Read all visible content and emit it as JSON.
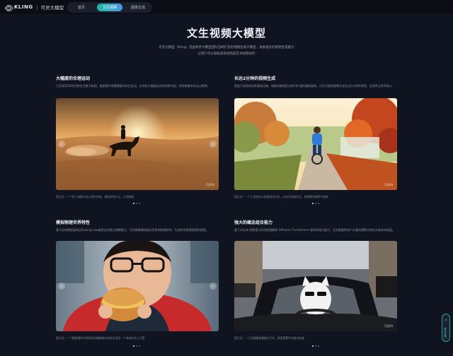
{
  "app": {
    "logo_text": "KLING",
    "logo_sub": "可灵大模型"
  },
  "nav": {
    "tabs": [
      {
        "label": "首页"
      },
      {
        "label": "文生视频"
      },
      {
        "label": "图像生成"
      }
    ]
  },
  "hero": {
    "title": "文生视频大模型",
    "desc_line1": "可灵大模型（Kling）是由快手大模型团队自研打造的视频生成大模型，具备强大的视频生成能力",
    "desc_line2": "让用户可以轻松高效地完成艺术视频创作"
  },
  "sections": [
    {
      "title": "大幅度的合理运动",
      "desc": "可灵采用3D时空联合注意力机制，能够更好地建模复杂时空运动，生成较大幅度运动的视频内容，同时能够符合运动规律。",
      "caption": "提示词：一个男人骑着马在沙漠中奔驰，扬起阵阵沙尘，夕阳映照",
      "watermark": "可灵AI"
    },
    {
      "title": "长达2分钟的视频生成",
      "desc": "得益于高效的训练基础设施、极致的推理优化和可扩展的基础架构，可灵大模型能够生成长达2分钟的视频，且帧率达到30fps。",
      "caption": "提示词：一个小男孩在公园里骑自行车，从秋天骑到冬天，周围景色随季节变换",
      "watermark": "可灵AI"
    },
    {
      "title": "模拟物理世界特性",
      "desc": "基于自研模型架构及Scaling Law激发出的强大建模能力，可灵能够模拟真实世界的物理特性，生成符合物理规律的视频。",
      "caption": "提示词：一个戴眼镜的中国男孩闭着眼睛在快餐店里吃一个美味的芝士汉堡",
      "watermark": "可灵AI"
    },
    {
      "title": "强大的概念组合能力",
      "desc": "基于对文本-视频语义的深刻理解和 Diffusion Transformer 架构的强大能力，可灵能够将用户丰富的想象力转化为具体的画面。",
      "caption": "提示词：一只白猫戴着墨镜在开车，周围是繁华的城市街道",
      "watermark": "可灵AI"
    }
  ],
  "floating": {
    "label": "意见反馈"
  }
}
